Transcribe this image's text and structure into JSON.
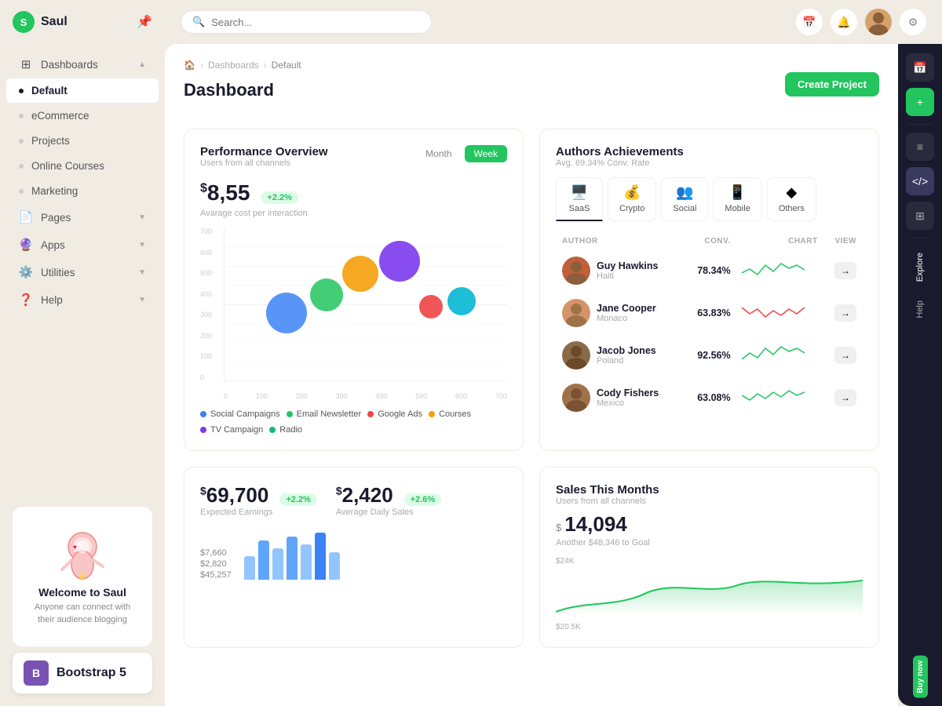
{
  "app": {
    "name": "Saul",
    "logo_letter": "S"
  },
  "sidebar": {
    "items": [
      {
        "label": "Dashboards",
        "icon": "⊞",
        "has_children": true,
        "active": false
      },
      {
        "label": "Default",
        "icon": "",
        "active": true,
        "is_sub": true
      },
      {
        "label": "eCommerce",
        "icon": "",
        "active": false,
        "is_sub": true
      },
      {
        "label": "Projects",
        "icon": "",
        "active": false,
        "is_sub": true
      },
      {
        "label": "Online Courses",
        "icon": "",
        "active": false,
        "is_sub": true
      },
      {
        "label": "Marketing",
        "icon": "",
        "active": false,
        "is_sub": true
      },
      {
        "label": "Pages",
        "icon": "📄",
        "has_children": true,
        "active": false
      },
      {
        "label": "Apps",
        "icon": "🔮",
        "has_children": true,
        "active": false
      },
      {
        "label": "Utilities",
        "icon": "⚙️",
        "has_children": true,
        "active": false
      },
      {
        "label": "Help",
        "icon": "❓",
        "has_children": true,
        "active": false
      }
    ],
    "footer": {
      "title": "Welcome to Saul",
      "subtitle": "Anyone can connect with their audience blogging"
    }
  },
  "topbar": {
    "search_placeholder": "Search...",
    "search_label": "Search _"
  },
  "breadcrumb": {
    "home": "🏠",
    "dashboards": "Dashboards",
    "current": "Default"
  },
  "page": {
    "title": "Dashboard",
    "create_button": "Create Project"
  },
  "performance": {
    "title": "Performance Overview",
    "subtitle": "Users from all channels",
    "value": "8,55",
    "currency": "$",
    "badge": "+2.2%",
    "desc": "Avarage cost per interaction",
    "tab_month": "Month",
    "tab_week": "Week",
    "legend": [
      {
        "label": "Social Campaigns",
        "color": "#3b82f6"
      },
      {
        "label": "Email Newsletter",
        "color": "#22c55e"
      },
      {
        "label": "Google Ads",
        "color": "#ef4444"
      },
      {
        "label": "Courses",
        "color": "#f59e0b"
      },
      {
        "label": "TV Campaign",
        "color": "#7c3aed"
      },
      {
        "label": "Radio",
        "color": "#10b981"
      }
    ],
    "bubbles": [
      {
        "x": 28,
        "y": 38,
        "size": 52,
        "color": "#3b82f6"
      },
      {
        "x": 37,
        "y": 30,
        "size": 42,
        "color": "#22c55e"
      },
      {
        "x": 47,
        "y": 22,
        "size": 46,
        "color": "#f59e0b"
      },
      {
        "x": 58,
        "y": 20,
        "size": 52,
        "color": "#7c3aed"
      },
      {
        "x": 67,
        "y": 34,
        "size": 30,
        "color": "#ef4444"
      },
      {
        "x": 76,
        "y": 32,
        "size": 36,
        "color": "#06b6d4"
      }
    ],
    "y_labels": [
      "700",
      "600",
      "500",
      "400",
      "300",
      "200",
      "100",
      "0"
    ],
    "x_labels": [
      "0",
      "100",
      "200",
      "300",
      "400",
      "500",
      "600",
      "700"
    ]
  },
  "authors": {
    "title": "Authors Achievements",
    "subtitle": "Avg. 69.34% Conv. Rate",
    "tabs": [
      {
        "label": "SaaS",
        "icon": "🖥️",
        "active": true
      },
      {
        "label": "Crypto",
        "icon": "💰",
        "active": false
      },
      {
        "label": "Social",
        "icon": "👥",
        "active": false
      },
      {
        "label": "Mobile",
        "icon": "📱",
        "active": false
      },
      {
        "label": "Others",
        "icon": "◆",
        "active": false
      }
    ],
    "table_headers": {
      "author": "AUTHOR",
      "conv": "CONV.",
      "chart": "CHART",
      "view": "VIEW"
    },
    "rows": [
      {
        "name": "Guy Hawkins",
        "country": "Haiti",
        "conv": "78.34%",
        "color": "#22c55e",
        "avatar_color": "#c0603a"
      },
      {
        "name": "Jane Cooper",
        "country": "Monaco",
        "conv": "63.83%",
        "color": "#ef4444",
        "avatar_color": "#d4956a"
      },
      {
        "name": "Jacob Jones",
        "country": "Poland",
        "conv": "92.56%",
        "color": "#22c55e",
        "avatar_color": "#8b6a4a"
      },
      {
        "name": "Cody Fishers",
        "country": "Mexico",
        "conv": "63.08%",
        "color": "#22c55e",
        "avatar_color": "#a0724a"
      }
    ]
  },
  "earnings": {
    "currency": "$",
    "value": "69,700",
    "badge": "+2.2%",
    "label": "Expected Earnings",
    "bars": [
      30,
      50,
      40,
      70,
      55,
      65,
      48
    ],
    "items": [
      {
        "label": "$7,660"
      },
      {
        "label": "$2,820"
      },
      {
        "label": "$45,257"
      }
    ]
  },
  "daily_sales": {
    "currency": "$",
    "value": "2,420",
    "badge": "+2.6%",
    "label": "Average Daily Sales"
  },
  "sales_month": {
    "title": "Sales This Months",
    "subtitle": "Users from all channels",
    "currency": "$",
    "value": "14,094",
    "goal_text": "Another $48,346 to Goal",
    "y_labels": [
      "$24K",
      "$20.5K"
    ]
  },
  "right_sidebar": {
    "tabs": [
      "Explore",
      "Help",
      "Buy now"
    ],
    "icons": [
      "📅",
      "+",
      "≡",
      "</>",
      "⊞"
    ]
  },
  "bootstrap": {
    "label": "Bootstrap 5"
  }
}
